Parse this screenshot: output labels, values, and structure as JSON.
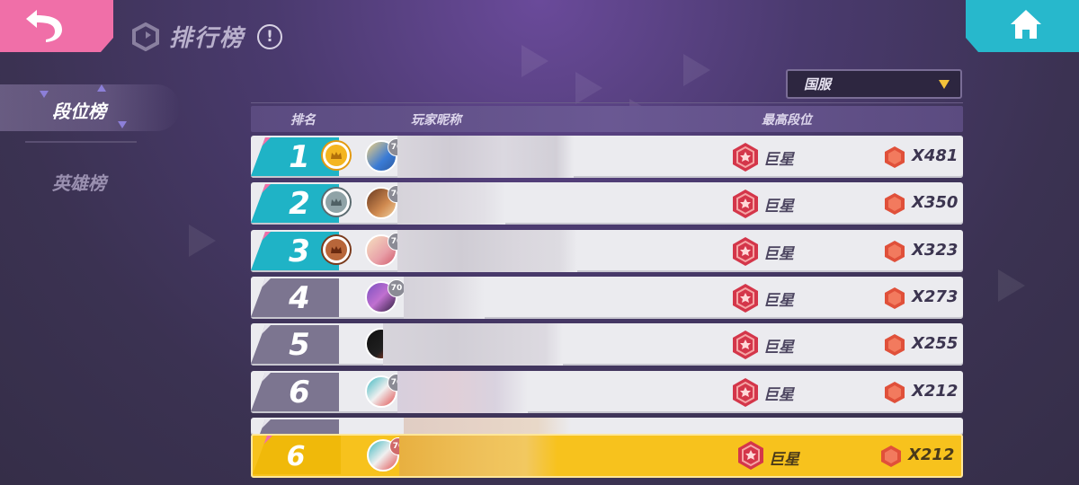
{
  "header": {
    "back_icon": "back-arrow-icon",
    "home_icon": "home-icon",
    "title": "排行榜",
    "info_label": "!"
  },
  "sidebar": {
    "tabs": [
      {
        "label": "段位榜",
        "active": true
      },
      {
        "label": "英雄榜",
        "active": false
      }
    ]
  },
  "server_select": {
    "value": "国服"
  },
  "table": {
    "columns": [
      "排名",
      "玩家昵称",
      "最高段位"
    ],
    "rows": [
      {
        "rank": "1",
        "medal": "gold",
        "level": "70",
        "tier": "巨星",
        "count": "X481"
      },
      {
        "rank": "2",
        "medal": "silver",
        "level": "70",
        "tier": "巨星",
        "count": "X350"
      },
      {
        "rank": "3",
        "medal": "bronze",
        "level": "70",
        "tier": "巨星",
        "count": "X323"
      },
      {
        "rank": "4",
        "medal": "",
        "level": "70",
        "tier": "巨星",
        "count": "X273"
      },
      {
        "rank": "5",
        "medal": "",
        "level": "",
        "tier": "巨星",
        "count": "X255"
      },
      {
        "rank": "6",
        "medal": "",
        "level": "70",
        "tier": "巨星",
        "count": "X212"
      }
    ],
    "self_row": {
      "rank": "6",
      "level": "70",
      "tier": "巨星",
      "count": "X212"
    }
  },
  "colors": {
    "accent_pink": "#f06fa8",
    "accent_teal": "#27b8cc",
    "self_gold": "#f7c21d"
  }
}
